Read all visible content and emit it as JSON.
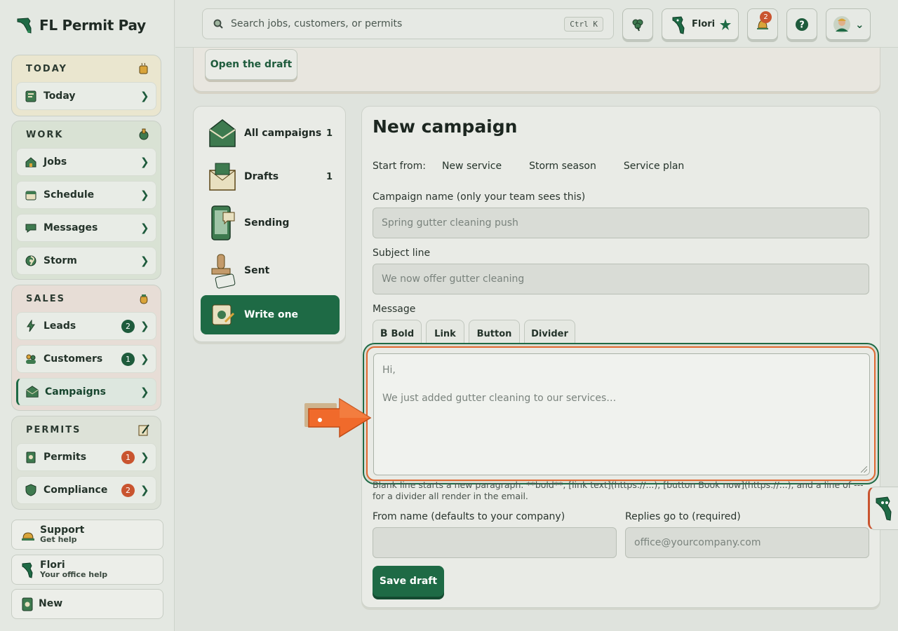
{
  "app": {
    "name": "FL Permit Pay"
  },
  "sidebar": {
    "groups": [
      {
        "title": "TODAY",
        "items": [
          {
            "label": "Today"
          }
        ]
      },
      {
        "title": "WORK",
        "items": [
          {
            "label": "Jobs"
          },
          {
            "label": "Schedule"
          },
          {
            "label": "Messages"
          },
          {
            "label": "Storm"
          }
        ]
      },
      {
        "title": "SALES",
        "items": [
          {
            "label": "Leads",
            "count": "2"
          },
          {
            "label": "Customers",
            "count": "1"
          },
          {
            "label": "Campaigns"
          }
        ]
      },
      {
        "title": "PERMITS",
        "items": [
          {
            "label": "Permits",
            "count": "1"
          },
          {
            "label": "Compliance",
            "count": "2"
          }
        ]
      }
    ],
    "support": {
      "label": "Support",
      "sub": "Get help"
    },
    "flori": {
      "label": "Flori",
      "sub": "Your office help"
    },
    "new": {
      "label": "New"
    }
  },
  "topbar": {
    "search_placeholder": "Search jobs, customers, or permits",
    "shortcut": "Ctrl K",
    "assistant_name": "Flori",
    "notifications_count": "2"
  },
  "main": {
    "open_draft_label": "Open the draft",
    "campaign_nav": [
      {
        "label": "All campaigns",
        "count": "1"
      },
      {
        "label": "Drafts",
        "count": "1"
      },
      {
        "label": "Sending",
        "count": ""
      },
      {
        "label": "Sent",
        "count": ""
      },
      {
        "label": "Write one",
        "count": ""
      }
    ],
    "form": {
      "title": "New campaign",
      "start_from_label": "Start from:",
      "start_options": [
        "New service",
        "Storm season",
        "Service plan"
      ],
      "campaign_name_label": "Campaign name (only your team sees this)",
      "campaign_name_placeholder": "Spring gutter cleaning push",
      "subject_label": "Subject line",
      "subject_placeholder": "We now offer gutter cleaning",
      "message_label": "Message",
      "format_buttons": [
        "Bold",
        "Link",
        "Button",
        "Divider"
      ],
      "bold_glyph": "B",
      "message_line1": "Hi,",
      "message_line2": "We just added gutter cleaning to our services…",
      "hint": "Blank line starts a new paragraph. **bold**, [link text](https://...), [button Book now](https://...), and a line of --- for a divider all render in the email.",
      "from_name_label": "From name (defaults to your company)",
      "from_name_placeholder": "",
      "replies_label": "Replies go to (required)",
      "replies_placeholder": "office@yourcompany.com",
      "save_label": "Save draft"
    }
  },
  "colors": {
    "accent": "#1e6a45",
    "alert": "#c9542f",
    "highlight": "#e0672f"
  }
}
